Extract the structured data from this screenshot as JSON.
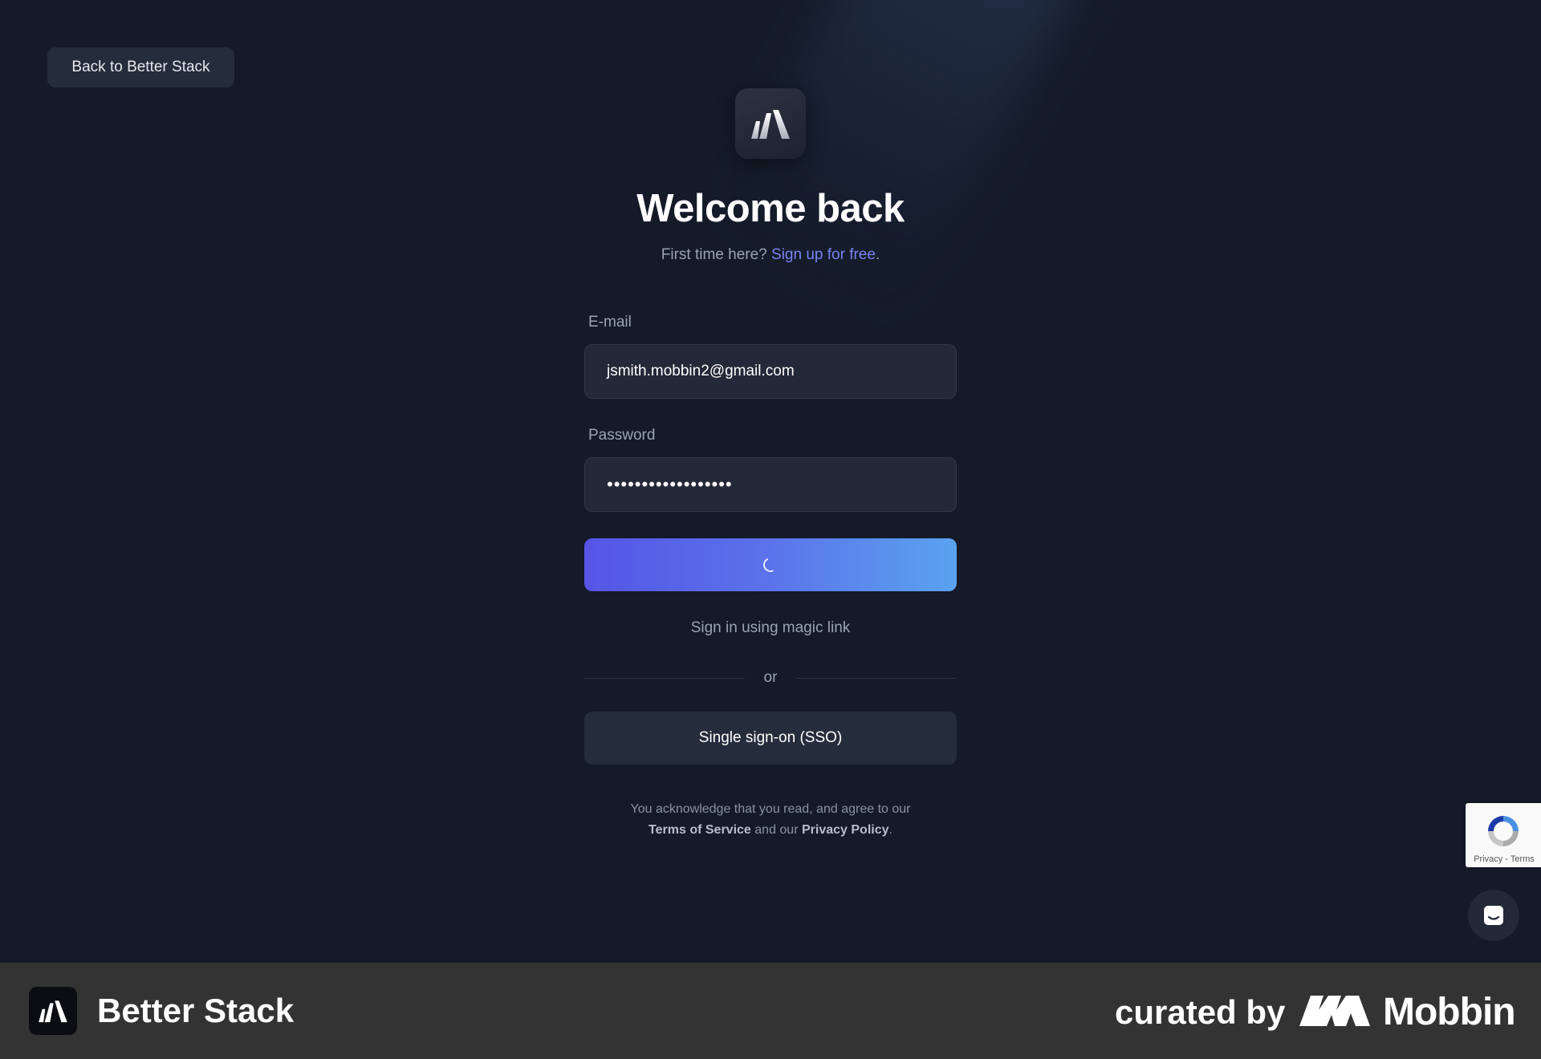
{
  "nav": {
    "back_label": "Back to Better Stack"
  },
  "header": {
    "title": "Welcome back",
    "subtitle_prefix": "First time here?",
    "signup_link": "Sign up for free",
    "subtitle_suffix": "."
  },
  "form": {
    "email_label": "E-mail",
    "email_value": "jsmith.mobbin2@gmail.com",
    "password_label": "Password",
    "password_value": "••••••••••••••••••",
    "submit_state": "loading",
    "magic_link": "Sign in using magic link",
    "divider": "or",
    "sso_label": "Single sign-on (SSO)"
  },
  "legal": {
    "line1": "You acknowledge that you read, and agree to our",
    "terms": "Terms of Service",
    "and": "and our",
    "privacy": "Privacy Policy",
    "end": "."
  },
  "recaptcha": {
    "text": "Privacy - Terms",
    "icon": "recaptcha-icon"
  },
  "chat": {
    "icon": "chat-icon"
  },
  "footer": {
    "app_name": "Better Stack",
    "curated_by": "curated by",
    "curator": "Mobbin"
  },
  "colors": {
    "background": "#141a28",
    "accent_link": "#7b83f2",
    "button_gradient_start": "#5555e6",
    "button_gradient_end": "#5aa3f0",
    "footer": "#333333"
  }
}
